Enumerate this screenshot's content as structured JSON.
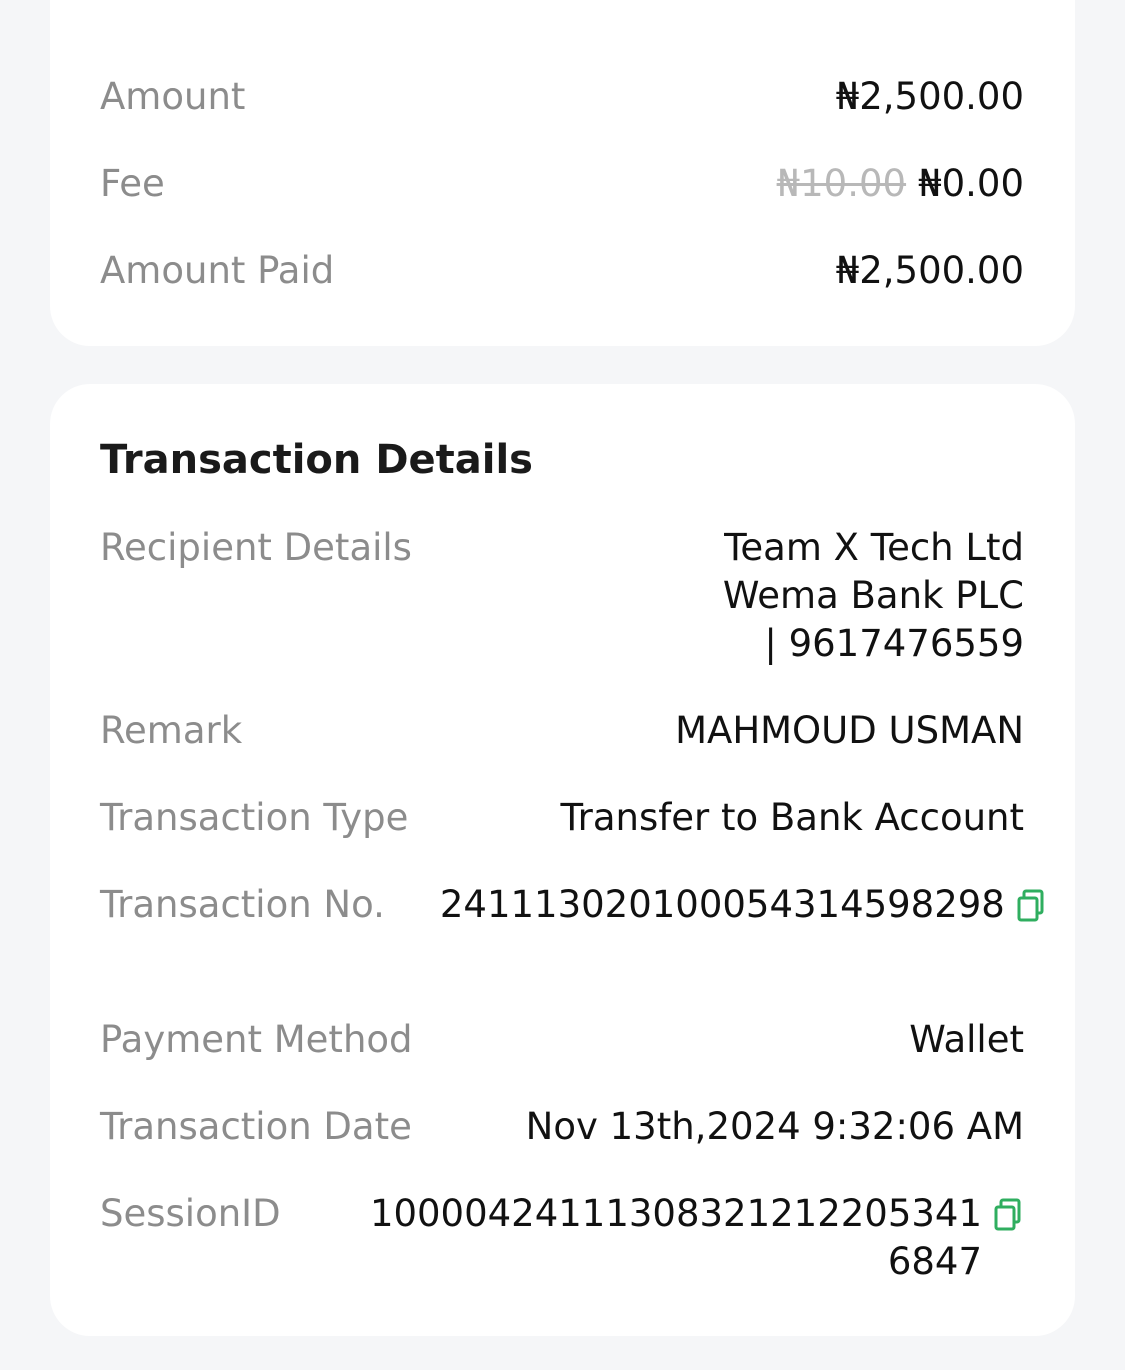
{
  "summary": {
    "amount_label": "Amount",
    "amount_value": "₦2,500.00",
    "fee_label": "Fee",
    "fee_original": "₦10.00",
    "fee_value": "₦0.00",
    "amount_paid_label": "Amount Paid",
    "amount_paid_value": "₦2,500.00"
  },
  "details": {
    "title": "Transaction Details",
    "recipient_label": "Recipient Details",
    "recipient_name": "Team X Tech Ltd",
    "recipient_bank": "Wema Bank PLC",
    "recipient_account": "| 9617476559",
    "remark_label": "Remark",
    "remark_value": "MAHMOUD USMAN",
    "type_label": "Transaction Type",
    "type_value": "Transfer to Bank Account",
    "number_label": "Transaction No.",
    "number_value": "241113020100054314598298",
    "method_label": "Payment Method",
    "method_value": "Wallet",
    "date_label": "Transaction Date",
    "date_value": "Nov 13th,2024 9:32:06 AM",
    "session_label": "SessionID",
    "session_value": "100004241113083212122053416847"
  },
  "colors": {
    "copy_icon": "#2fae5f",
    "label": "#8c8c8c",
    "value": "#111111",
    "strike": "#b8b8b8"
  },
  "icons": {
    "copy": "copy-icon"
  }
}
